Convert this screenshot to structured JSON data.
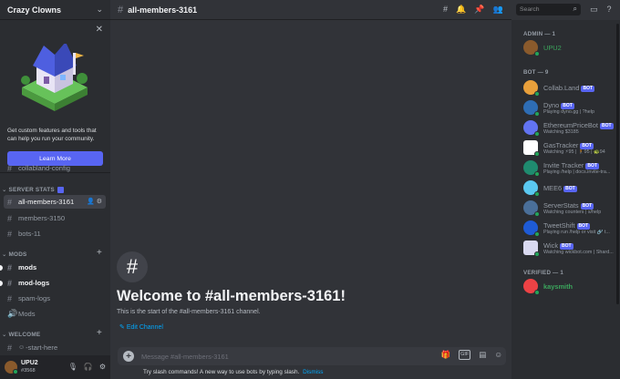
{
  "sidebar": {
    "guild_name": "Crazy Clowns",
    "promo": {
      "text": "Get custom features and tools that can help you run your community.",
      "button": "Learn More"
    },
    "channels": {
      "collabland": "collabland-config",
      "all_members": "all-members-3161",
      "members": "members-3150",
      "bots": "bots-11",
      "mods": "mods",
      "mod_logs": "mod-logs",
      "spam_logs": "spam-logs",
      "mods2": "Mods",
      "start_here": "-start-here"
    },
    "categories": {
      "server_stats": "SERVER STATS",
      "mods": "MODS",
      "welcome": "WELCOME"
    }
  },
  "user_panel": {
    "name": "UPU2",
    "tag": "#3568"
  },
  "topbar": {
    "channel": "all-members-3161",
    "search_placeholder": "Search"
  },
  "welcome": {
    "title": "Welcome to #all-members-3161!",
    "subtitle": "This is the start of the #all-members-3161 channel.",
    "edit": "Edit Channel"
  },
  "composer": {
    "placeholder": "Message #all-members-3161",
    "gif": "GIF",
    "tip": "Try slash commands! A new way to use bots by typing slash.",
    "dismiss": "Dismiss"
  },
  "members": {
    "bot_tag": "BOT",
    "admin_header": "ADMIN — 1",
    "bot_header": "BOT — 9",
    "verified_header": "VERIFIED — 1",
    "admin": [
      {
        "name": "UPU2",
        "color": "#3ba55c"
      }
    ],
    "bots": [
      {
        "name": "Collab.Land",
        "status": "",
        "color": "#e9a03b"
      },
      {
        "name": "Dyno",
        "status": "Playing dyno.gg | ?help",
        "color": "#2e6db4"
      },
      {
        "name": "EthereumPriceBot",
        "status": "Watching $3185",
        "color": "#6274f2"
      },
      {
        "name": "GasTracker",
        "status": "Watching ⚡95 | 🚶95 | 🐢94",
        "color": "#ffffff"
      },
      {
        "name": "Invite Tracker",
        "status": "Playing /help | docs.invite-tra...",
        "color": "#1f8b6f"
      },
      {
        "name": "MEE6",
        "status": "",
        "color": "#5ac8f0"
      },
      {
        "name": "ServerStats",
        "status": "Watching counters | s/help",
        "color": "#4a6f99"
      },
      {
        "name": "TweetShift",
        "status": "Playing run /help or visit 🔗 t...",
        "color": "#1e5bd6"
      },
      {
        "name": "Wick",
        "status": "Watching wickbot.com | Shard...",
        "color": "#d9d9f0"
      }
    ],
    "verified": [
      {
        "name": "kaysmith",
        "color": "#ed4245"
      }
    ]
  }
}
